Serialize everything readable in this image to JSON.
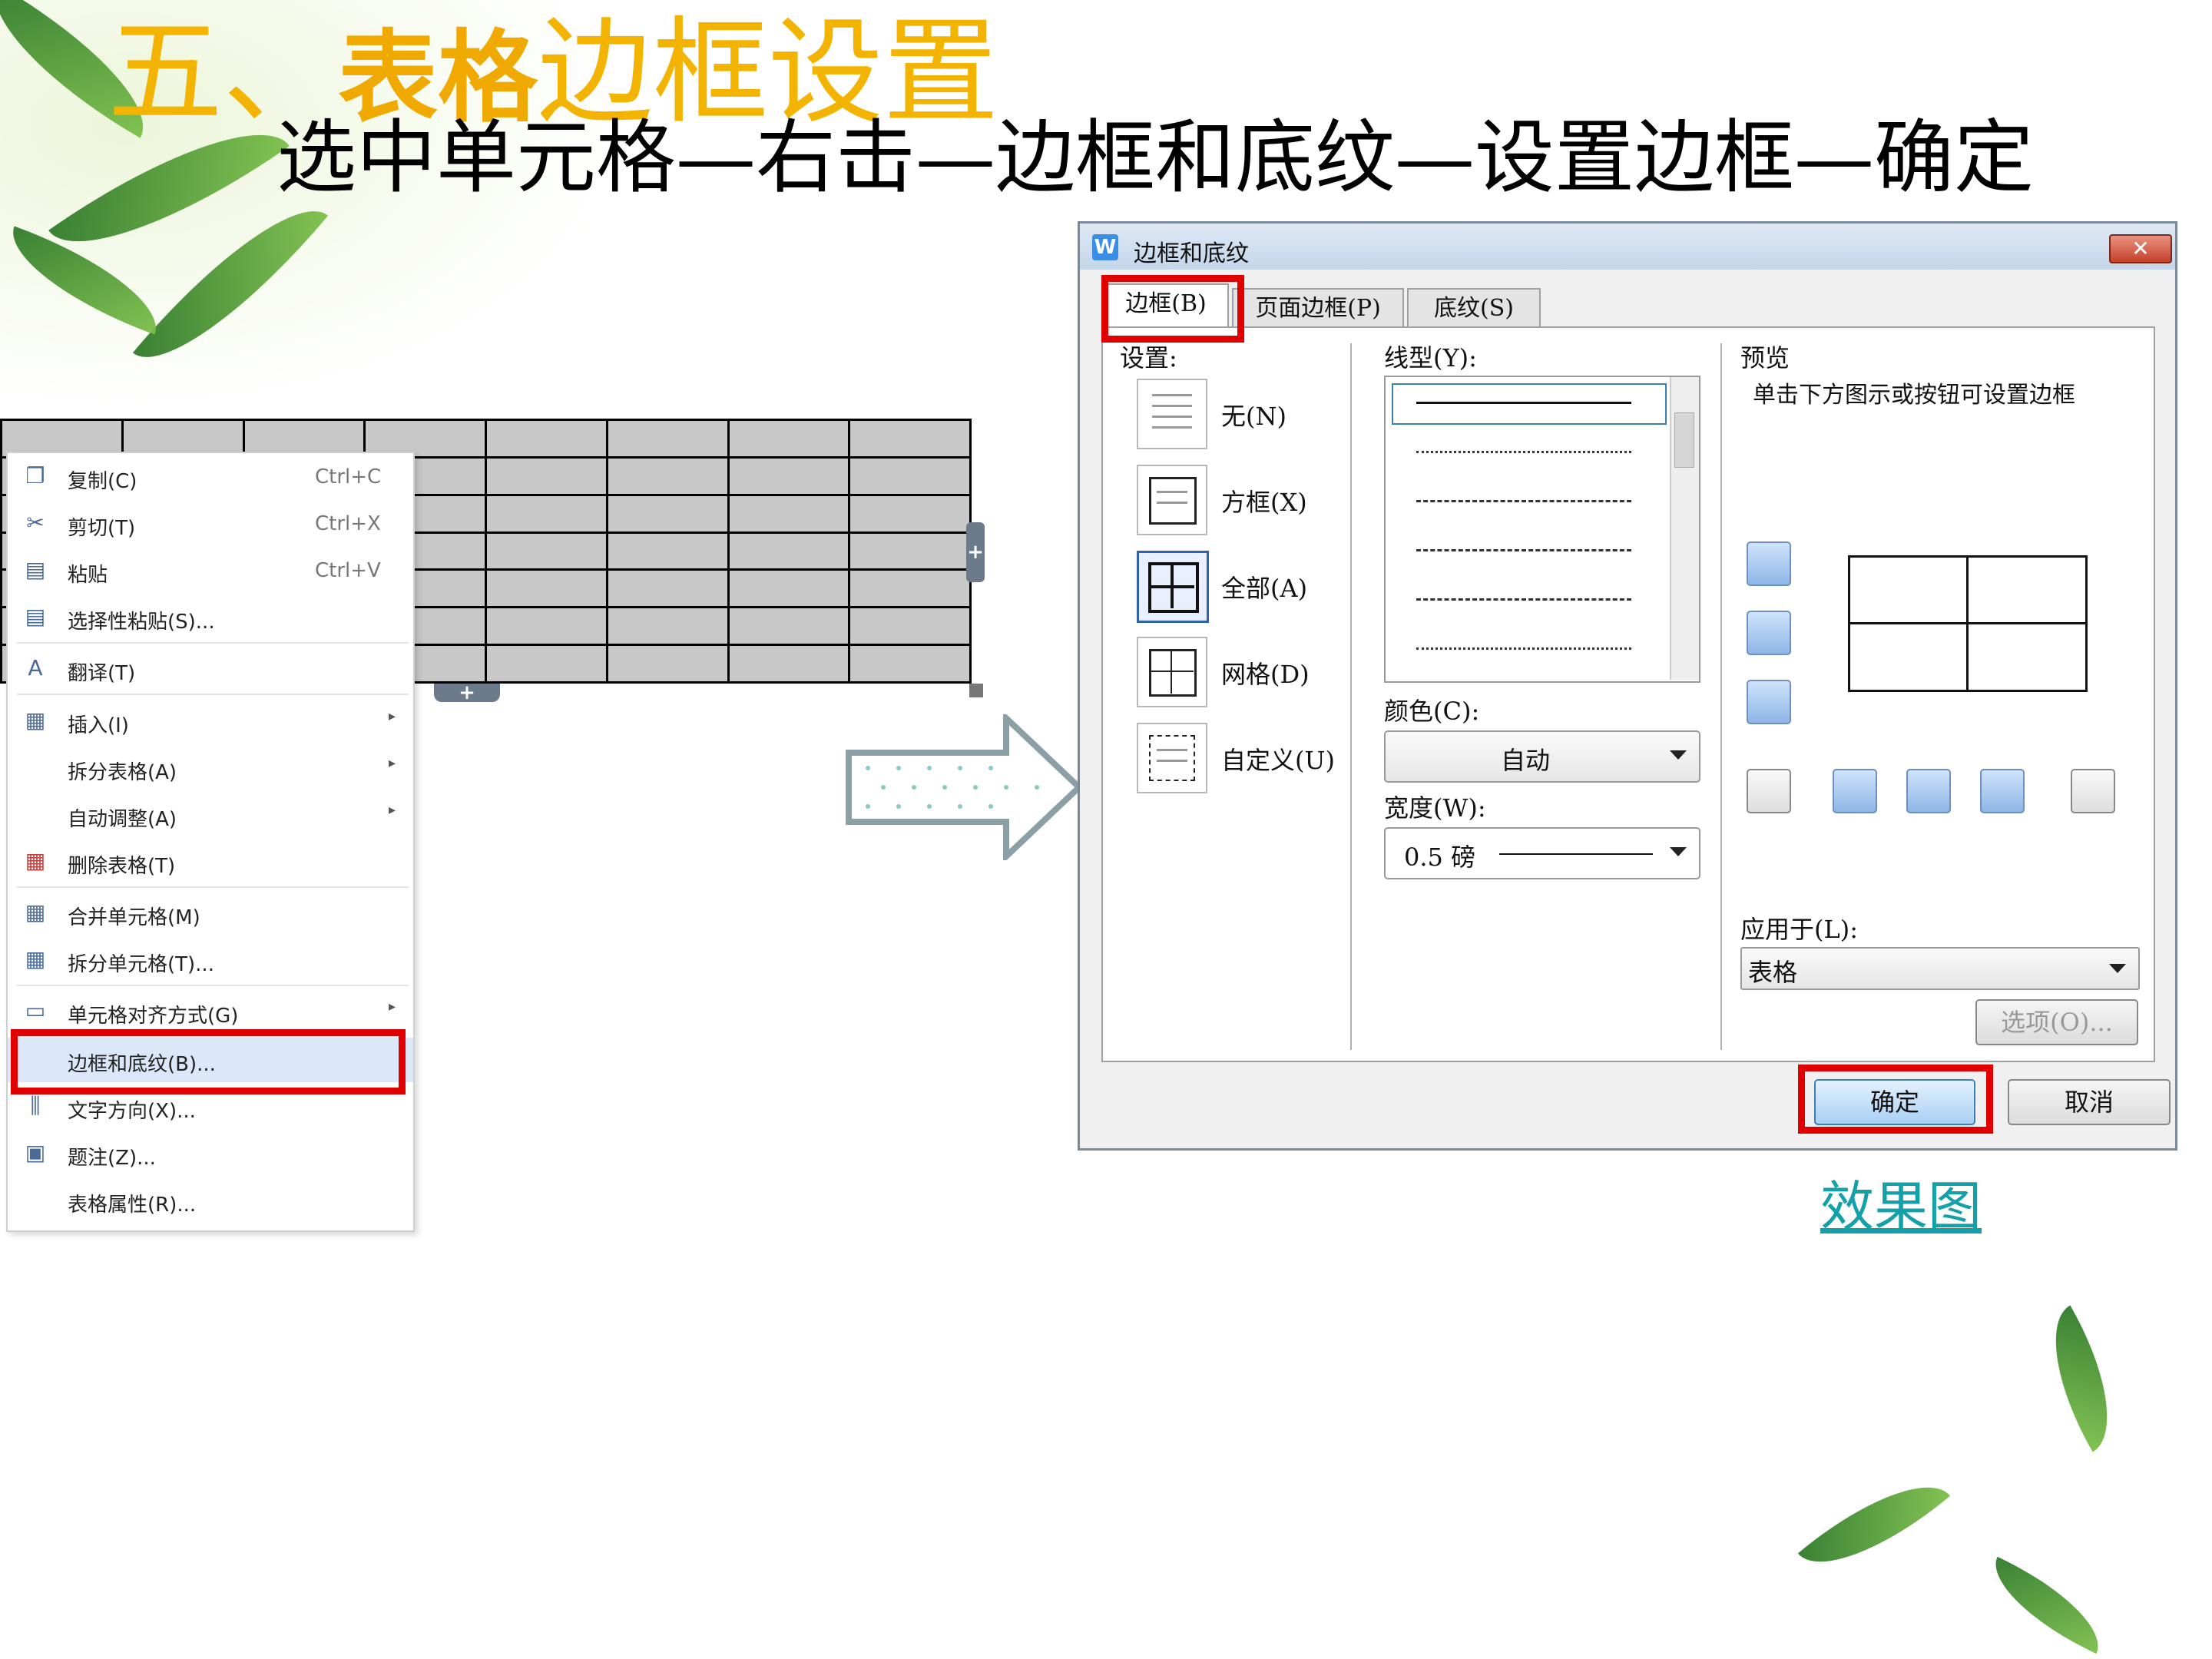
{
  "title": {
    "main_prefix": "五、",
    "main_bold": "表格",
    "main_suffix": "边框设置"
  },
  "subtitle": "选中单元格—右击—边框和底纹—设置边框—确定",
  "context_menu": {
    "items": [
      {
        "label": "复制(C)",
        "shortcut": "Ctrl+C",
        "icon": "copy-icon"
      },
      {
        "label": "剪切(T)",
        "shortcut": "Ctrl+X",
        "icon": "cut-icon"
      },
      {
        "label": "粘贴",
        "shortcut": "Ctrl+V",
        "icon": "paste-icon"
      },
      {
        "label": "选择性粘贴(S)...",
        "shortcut": "",
        "icon": "paste-special-icon"
      },
      {
        "label": "翻译(T)",
        "shortcut": "",
        "icon": "translate-icon"
      },
      {
        "label": "插入(I)",
        "shortcut": "",
        "icon": "insert-table-icon"
      },
      {
        "label": "拆分表格(A)",
        "shortcut": "",
        "icon": ""
      },
      {
        "label": "自动调整(A)",
        "shortcut": "",
        "icon": ""
      },
      {
        "label": "删除表格(T)",
        "shortcut": "",
        "icon": "delete-table-icon"
      },
      {
        "label": "合并单元格(M)",
        "shortcut": "",
        "icon": "merge-cells-icon"
      },
      {
        "label": "拆分单元格(T)...",
        "shortcut": "",
        "icon": "split-cells-icon"
      },
      {
        "label": "单元格对齐方式(G)",
        "shortcut": "",
        "icon": "cell-align-icon"
      },
      {
        "label": "边框和底纹(B)...",
        "shortcut": "",
        "icon": ""
      },
      {
        "label": "文字方向(X)...",
        "shortcut": "",
        "icon": "text-direction-icon"
      },
      {
        "label": "题注(Z)...",
        "shortcut": "",
        "icon": "caption-icon"
      },
      {
        "label": "表格属性(R)...",
        "shortcut": "",
        "icon": ""
      }
    ]
  },
  "dialog": {
    "title": "边框和底纹",
    "tabs": [
      "边框(B)",
      "页面边框(P)",
      "底纹(S)"
    ],
    "settings_label": "设置:",
    "settings": [
      "无(N)",
      "方框(X)",
      "全部(A)",
      "网格(D)",
      "自定义(U)"
    ],
    "line_style_label": "线型(Y):",
    "color_label": "颜色(C):",
    "color_value": "自动",
    "width_label": "宽度(W):",
    "width_value": "0.5  磅",
    "preview_label": "预览",
    "preview_hint": "单击下方图示或按钮可设置边框",
    "apply_label": "应用于(L):",
    "apply_value": "表格",
    "options_button": "选项(O)...",
    "ok_button": "确定",
    "cancel_button": "取消",
    "close_symbol": "✕",
    "logo": "W"
  },
  "effect_link": "效果图",
  "colors": {
    "title": "#f2b400",
    "highlight": "#e10000",
    "link": "#14a0a8"
  }
}
